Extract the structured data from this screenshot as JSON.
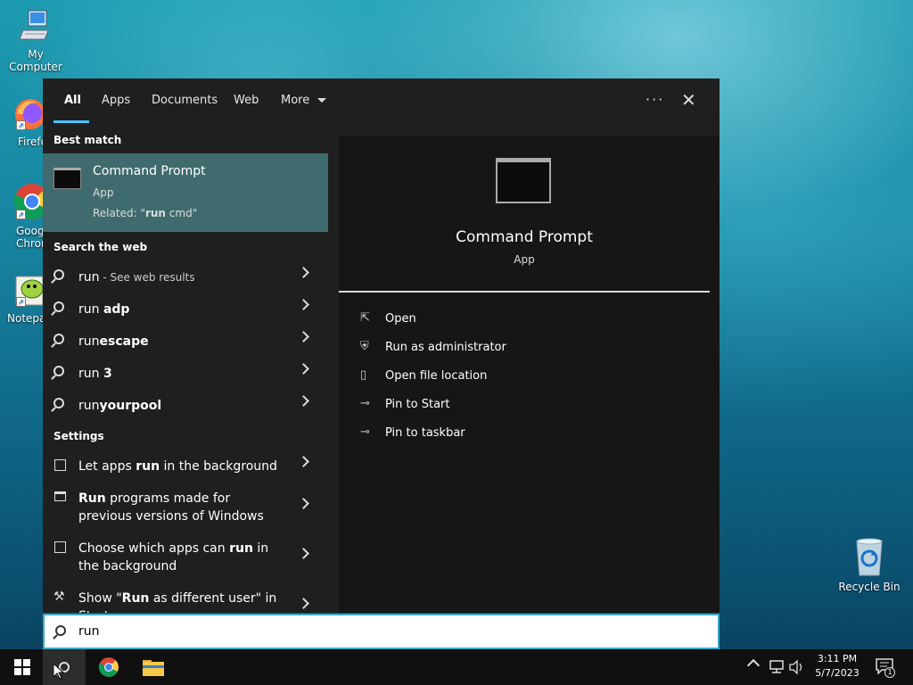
{
  "desktop": {
    "icons": [
      {
        "label": "My Computer"
      },
      {
        "label": "Firefox"
      },
      {
        "label": "Google Chrome"
      },
      {
        "label": "Notepad++"
      },
      {
        "label": "Recycle Bin"
      }
    ]
  },
  "search": {
    "tabs": [
      {
        "label": "All"
      },
      {
        "label": "Apps"
      },
      {
        "label": "Documents"
      },
      {
        "label": "Web"
      },
      {
        "label": "More"
      }
    ],
    "more_icon": "ellipsis-icon",
    "close_icon": "close-icon",
    "best_match": {
      "header": "Best match",
      "title": "Command Prompt",
      "type": "App",
      "related_prefix": "Related: \"",
      "related_bold": "run",
      "related_suffix": " cmd\""
    },
    "web": {
      "header": "Search the web",
      "items": [
        {
          "pre": "",
          "bold": "",
          "plain": "run",
          "dim": " - See web results"
        },
        {
          "pre": "run ",
          "bold": "adp",
          "plain": "",
          "dim": ""
        },
        {
          "pre": "run",
          "bold": "escape",
          "plain": "",
          "dim": ""
        },
        {
          "pre": "run ",
          "bold": "3",
          "plain": "",
          "dim": ""
        },
        {
          "pre": "run",
          "bold": "yourpool",
          "plain": "",
          "dim": ""
        }
      ]
    },
    "settings": {
      "header": "Settings",
      "items": [
        {
          "a": "Let apps ",
          "b": "run",
          "c": " in the background"
        },
        {
          "a": "",
          "b": "Run",
          "c": " programs made for previous versions of Windows"
        },
        {
          "a": "Choose which apps can ",
          "b": "run",
          "c": " in the background"
        },
        {
          "a": "Show \"",
          "b": "Run",
          "c": " as different user\" in Start"
        }
      ]
    },
    "preview": {
      "title": "Command Prompt",
      "subtitle": "App",
      "actions": [
        {
          "label": "Open",
          "icon": "open-icon"
        },
        {
          "label": "Run as administrator",
          "icon": "shield-icon"
        },
        {
          "label": "Open file location",
          "icon": "folder-icon"
        },
        {
          "label": "Pin to Start",
          "icon": "pin-icon"
        },
        {
          "label": "Pin to taskbar",
          "icon": "pin-icon"
        }
      ]
    },
    "query": "run"
  },
  "taskbar": {
    "time": "3:11 PM",
    "date": "5/7/2023",
    "notification_count": "1"
  },
  "colors": {
    "accent": "#4cc2ff",
    "best_match_bg": "#3f6b6e",
    "flyout_bg": "#1f1f1f",
    "taskbar_bg": "#101010"
  }
}
